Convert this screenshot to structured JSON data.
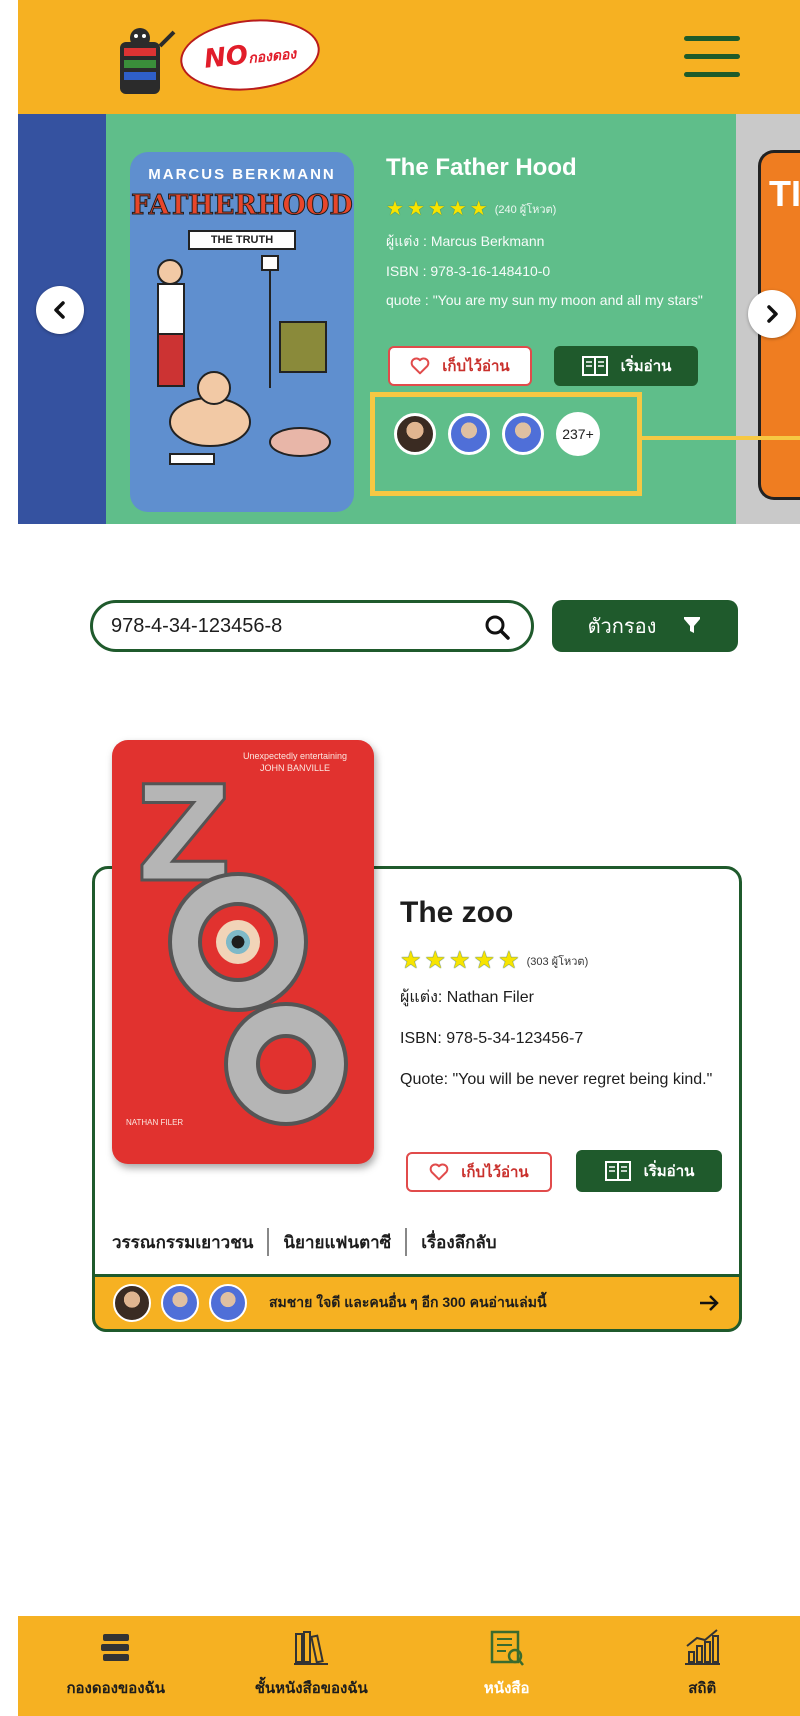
{
  "brand": {
    "logo_text": "NO",
    "logo_subtext": "กองดอง"
  },
  "carousel": {
    "featured": {
      "cover_author": "MARCUS BERKMANN",
      "cover_title": "FATHERHOOD",
      "cover_subtitle": "THE TRUTH",
      "title": "The Father Hood",
      "rating": 5,
      "reviews": "(240 ผู้โหวต)",
      "author": "ผู้แต่ง : Marcus Berkmann",
      "isbn": "ISBN : 978-3-16-148410-0",
      "quote": "quote : \"You are my sun my moon and all my stars\"",
      "save_label": "เก็บไว้อ่าน",
      "read_label": "เริ่มอ่าน",
      "readers_count": "237+"
    },
    "next_cover_text": "TI"
  },
  "search": {
    "value": "978-4-34-123456-8",
    "placeholder": "",
    "filter_label": "ตัวกรอง"
  },
  "book": {
    "cover_tagline": "Unexpectedly entertaining JOHN BANVILLE",
    "cover_author": "NATHAN FILER",
    "title": "The zoo",
    "rating": 5,
    "reviews": "(303 ผู้โหวต)",
    "author": "ผู้แต่ง: Nathan Filer",
    "isbn": "ISBN: 978-5-34-123456-7",
    "quote": "Quote: \"You will be never regret being kind.\"",
    "save_label": "เก็บไว้อ่าน",
    "read_label": "เริ่มอ่าน",
    "genres": [
      "วรรณกรรมเยาวชน",
      "นิยายแฟนตาซี",
      "เรื่องลึกลับ"
    ],
    "readers_text": "สมชาย ใจดี และคนอื่น ๆ อีก 300 คนอ่านเล่มนี้"
  },
  "bottom_nav": [
    {
      "label": "กองดองของฉัน",
      "icon": "book-stack-icon",
      "active": false
    },
    {
      "label": "ชั้นหนังสือของฉัน",
      "icon": "bookshelf-icon",
      "active": false
    },
    {
      "label": "หนังสือ",
      "icon": "open-book-search-icon",
      "active": true
    },
    {
      "label": "สถิติ",
      "icon": "stats-chart-icon",
      "active": false
    }
  ],
  "colors": {
    "header": "#f6b122",
    "dark_green": "#1f5a2c",
    "carousel_green": "#5fbe8a",
    "highlight": "#f6c843"
  }
}
